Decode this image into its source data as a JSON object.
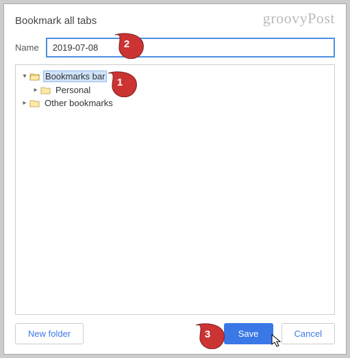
{
  "watermark": "groovyPost",
  "dialog": {
    "title": "Bookmark all tabs",
    "name_label": "Name",
    "name_value": "2019-07-08",
    "tree": {
      "items": [
        {
          "label": "Bookmarks bar",
          "indent": 0,
          "expanded": true,
          "open": true,
          "selected": true
        },
        {
          "label": "Personal",
          "indent": 1,
          "expanded": false,
          "open": false,
          "selected": false
        },
        {
          "label": "Other bookmarks",
          "indent": 0,
          "expanded": false,
          "open": false,
          "selected": false
        }
      ]
    },
    "buttons": {
      "new_folder": "New folder",
      "save": "Save",
      "cancel": "Cancel"
    }
  },
  "callouts": {
    "one": "1",
    "two": "2",
    "three": "3"
  },
  "colors": {
    "accent": "#3b78e7",
    "callout": "#cc3333"
  }
}
